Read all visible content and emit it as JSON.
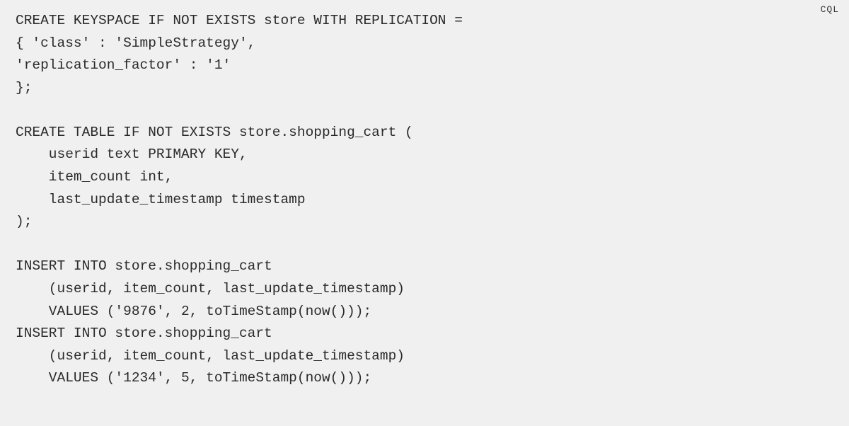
{
  "language_badge": "CQL",
  "code": "CREATE KEYSPACE IF NOT EXISTS store WITH REPLICATION =\n{ 'class' : 'SimpleStrategy',\n'replication_factor' : '1'\n};\n\nCREATE TABLE IF NOT EXISTS store.shopping_cart (\n    userid text PRIMARY KEY,\n    item_count int,\n    last_update_timestamp timestamp\n);\n\nINSERT INTO store.shopping_cart\n    (userid, item_count, last_update_timestamp)\n    VALUES ('9876', 2, toTimeStamp(now()));\nINSERT INTO store.shopping_cart\n    (userid, item_count, last_update_timestamp)\n    VALUES ('1234', 5, toTimeStamp(now()));"
}
